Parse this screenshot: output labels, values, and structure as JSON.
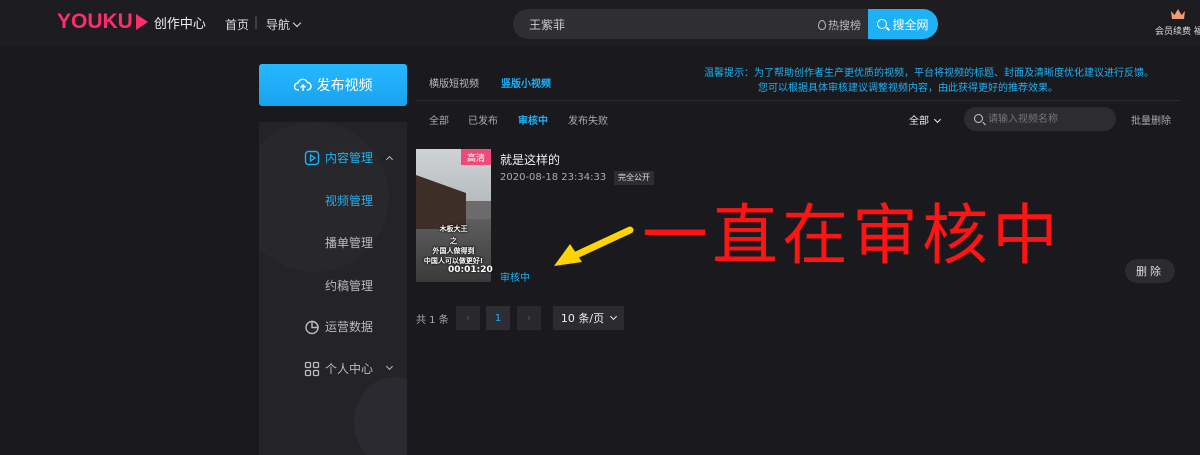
{
  "header": {
    "logo_text": "YOUKU",
    "logo_sub": "创作中心",
    "home": "首页",
    "separator": "|",
    "nav": "导航",
    "search_value": "王紫菲",
    "hot_search": "热搜榜",
    "search_button": "搜全网",
    "vip_label": "会员续费 福"
  },
  "sidebar": {
    "publish_button": "发布视频",
    "items": [
      {
        "label": "内容管理",
        "icon": "play-square-icon"
      },
      {
        "label": "视频管理"
      },
      {
        "label": "播单管理"
      },
      {
        "label": "约稿管理"
      },
      {
        "label": "运营数据",
        "icon": "pie-chart-icon"
      },
      {
        "label": "个人中心",
        "icon": "grid-icon"
      }
    ]
  },
  "content": {
    "tabs": [
      "横版短视频",
      "竖版小视频"
    ],
    "notice_line1": "温馨提示：为了帮助创作者生产更优质的视频，平台将视频的标题、封面及清晰度优化建议进行反馈。",
    "notice_line2": "您可以根据具体审核建议调整视频内容，由此获得更好的推荐效果。",
    "filters": [
      "全部",
      "已发布",
      "审核中",
      "发布失败"
    ],
    "all_select": "全部",
    "video_search_placeholder": "请输入视频名称",
    "batch_delete": "批量删除"
  },
  "video": {
    "badge": "高清",
    "thumb_lines": [
      "木板大王",
      "之",
      "外国人做得到",
      "中国人可以做更好!"
    ],
    "duration": "00:01:20",
    "title": "就是这样的",
    "date": "2020-08-18 23:34:33",
    "visibility": "完全公开",
    "status": "审核中",
    "delete_button": "删除"
  },
  "pagination": {
    "total": "共 1 条",
    "prev": "‹",
    "page": "1",
    "next": "›",
    "page_size": "10 条/页"
  },
  "annotation": {
    "text": "一直在审核中",
    "color": "#ff1313",
    "arrow_color": "#ffd400"
  },
  "colors": {
    "accent": "#1fb1f5",
    "brand_pink": "#ff2d6b",
    "background": "#1a1a1e"
  }
}
